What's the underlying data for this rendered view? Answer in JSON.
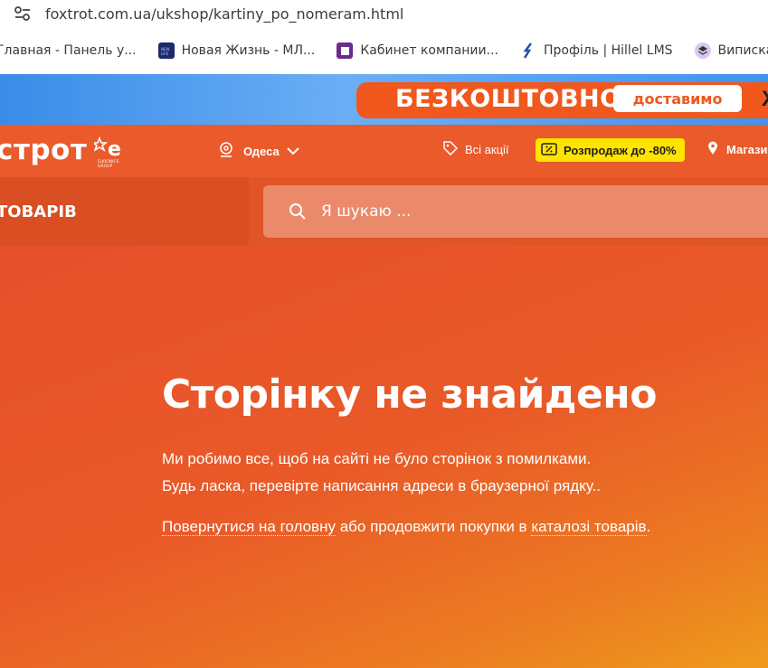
{
  "browser": {
    "url": "foxtrot.com.ua/ukshop/kartiny_po_nomeram.html",
    "bookmarks": [
      {
        "label": "Главная - Панель у...",
        "icon": "none"
      },
      {
        "label": "Новая Жизнь - МЛ...",
        "icon": "newlife-icon"
      },
      {
        "label": "Кабинет компании...",
        "icon": "square-icon"
      },
      {
        "label": "Профіль | Hillel LMS",
        "icon": "hillel-icon"
      },
      {
        "label": "Виписка оцін",
        "icon": "layers-icon"
      }
    ]
  },
  "promo": {
    "headline": "БЕЗКОШТОВНО",
    "button": "доставимо",
    "tail": "Х"
  },
  "header": {
    "logo": "строт",
    "city": "Одеса",
    "promotions": "Всі акції",
    "sale": "Розпродаж до -80%",
    "stores": "Магази"
  },
  "nav": {
    "catalog": "ТОВАРІВ",
    "search_placeholder": "Я шукаю ..."
  },
  "main": {
    "title": "Сторінку не знайдено",
    "line1": "Ми робимо все, щоб на сайті не було сторінок з помилками.",
    "line2": "Будь ласка, перевірте написання адреси в браузерної рядку..",
    "home_link": "Повернутися на головну",
    "middle": " або продовжити покупки в ",
    "catalog_link": "каталозі товарів",
    "end": "."
  },
  "colors": {
    "brand_orange": "#e8562a",
    "banner_blue": "#3a8ce8",
    "sale_yellow": "#ffe400"
  }
}
